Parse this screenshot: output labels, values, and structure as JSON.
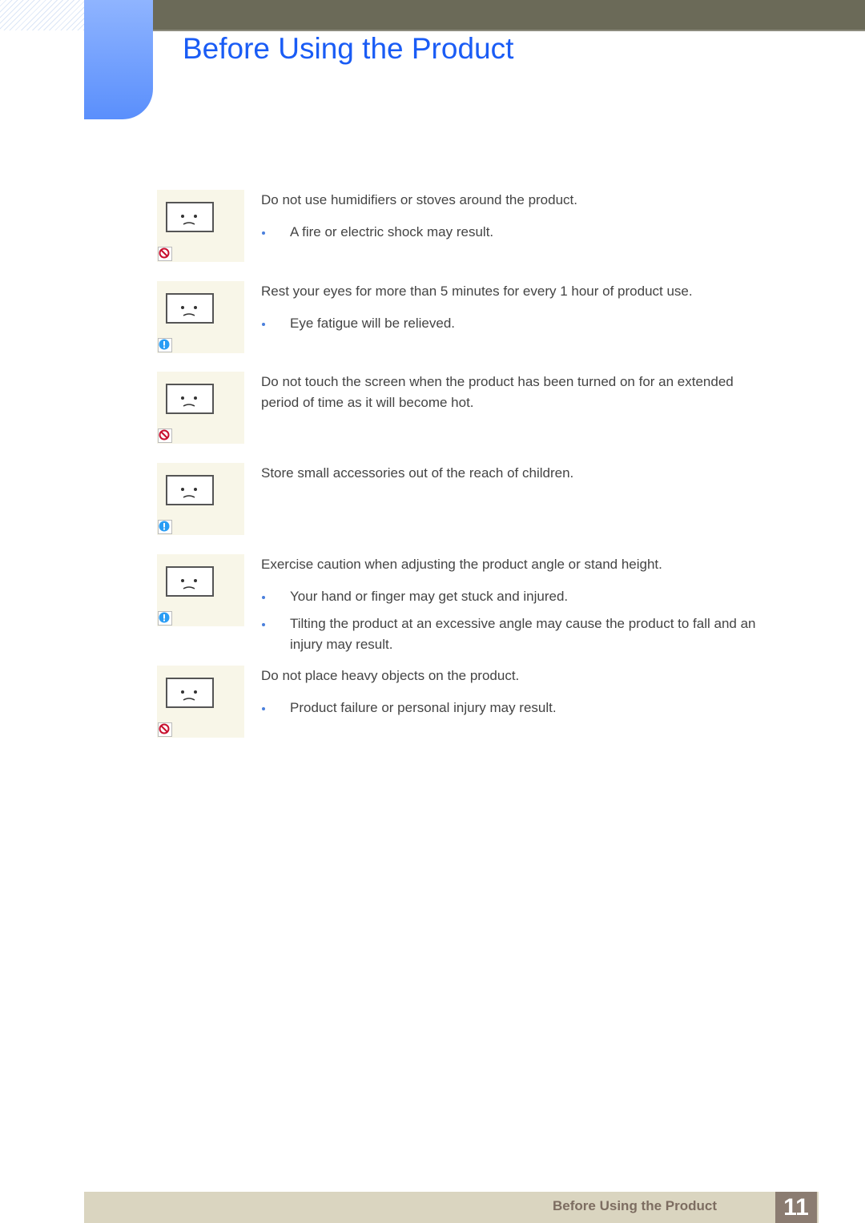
{
  "header": {
    "title": "Before Using the Product"
  },
  "items": [
    {
      "illustration": "humidifier-near-monitor-illustration",
      "badge": "prohibited-icon",
      "text": "Do not use humidifiers or stoves around the product.",
      "bullets": [
        "A fire or electric shock may result."
      ]
    },
    {
      "illustration": "rest-eyes-illustration",
      "badge": "info-icon",
      "text": "Rest your eyes for more than 5 minutes for every 1 hour of product use.",
      "bullets": [
        "Eye fatigue will be relieved."
      ]
    },
    {
      "illustration": "touching-hot-screen-illustration",
      "badge": "prohibited-icon",
      "text": "Do not touch the screen when the product has been turned on for an extended period of time as it will become hot.",
      "bullets": []
    },
    {
      "illustration": "child-reaching-accessories-illustration",
      "badge": "info-icon",
      "text": "Store small accessories out of the reach of children.",
      "bullets": []
    },
    {
      "illustration": "adjusting-stand-illustration",
      "badge": "info-icon",
      "text": "Exercise caution when adjusting the product angle or stand height.",
      "bullets": [
        "Your hand or finger may get stuck and injured.",
        "Tilting the product at an excessive angle may cause the product to fall and an injury may result."
      ]
    },
    {
      "illustration": "heavy-objects-on-monitor-illustration",
      "badge": "prohibited-icon",
      "text": "Do not place heavy objects on the product.",
      "bullets": [
        "Product failure or personal injury may result."
      ]
    }
  ],
  "footer": {
    "section": "Before Using the Product",
    "page": "11"
  }
}
